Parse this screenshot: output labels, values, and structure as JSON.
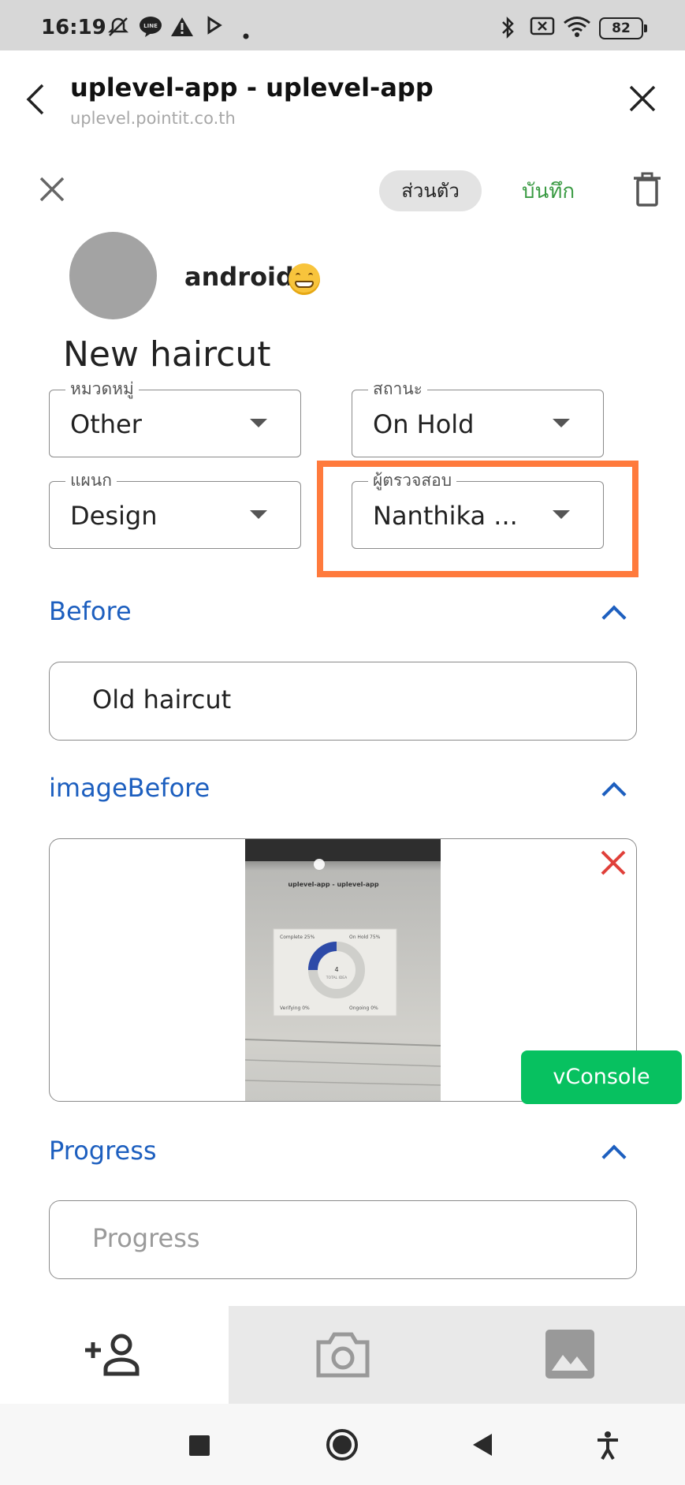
{
  "status_bar": {
    "time": "16:19",
    "battery": "82"
  },
  "header": {
    "title": "uplevel-app - uplevel-app",
    "subtitle": "uplevel.pointit.co.th"
  },
  "toolbar": {
    "visibility_label": "ส่วนตัว",
    "save_label": "บันทึก"
  },
  "user": {
    "name": "android"
  },
  "form": {
    "title": "New haircut",
    "category": {
      "label": "หมวดหมู่",
      "value": "Other"
    },
    "status": {
      "label": "สถานะ",
      "value": "On Hold"
    },
    "department": {
      "label": "แผนก",
      "value": "Design"
    },
    "reviewer": {
      "label": "ผู้ตรวจสอบ",
      "value": "Nanthika ..."
    }
  },
  "sections": {
    "before": {
      "title": "Before",
      "value": "Old haircut"
    },
    "image_before": {
      "title": "imageBefore"
    },
    "progress": {
      "title": "Progress",
      "placeholder": "Progress"
    }
  },
  "vconsole_label": "vConsole",
  "photo_preview": {
    "title": "uplevel-app - uplevel-app",
    "legend": [
      "Complete 25%",
      "On Hold 75%",
      "Verifying 0%",
      "Ongoing 0%"
    ],
    "center_value": "4",
    "center_label": "TOTAL IDEA"
  },
  "colors": {
    "accent": "#1d5fbf",
    "save": "#3b9b44",
    "highlight": "#ff7a3c",
    "vconsole": "#07c160",
    "danger": "#e0403a"
  },
  "icons": [
    "back-arrow-icon",
    "close-icon",
    "trash-icon",
    "chevron-up-icon",
    "add-person-icon",
    "camera-icon",
    "gallery-icon"
  ]
}
